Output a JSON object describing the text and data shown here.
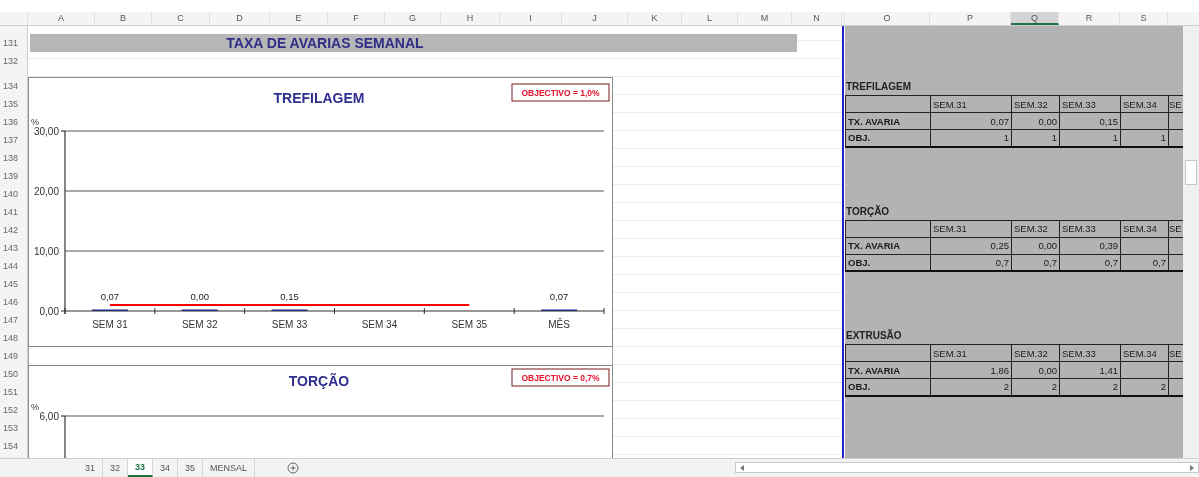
{
  "column_headers": [
    {
      "label": "A",
      "selected": false
    },
    {
      "label": "B",
      "selected": false
    },
    {
      "label": "C",
      "selected": false
    },
    {
      "label": "D",
      "selected": false
    },
    {
      "label": "E",
      "selected": false
    },
    {
      "label": "F",
      "selected": false
    },
    {
      "label": "G",
      "selected": false
    },
    {
      "label": "H",
      "selected": false
    },
    {
      "label": "I",
      "selected": false
    },
    {
      "label": "J",
      "selected": false
    },
    {
      "label": "K",
      "selected": false
    },
    {
      "label": "L",
      "selected": false
    },
    {
      "label": "M",
      "selected": false
    },
    {
      "label": "N",
      "selected": false
    },
    {
      "label": "O",
      "selected": false
    },
    {
      "label": "P",
      "selected": false
    },
    {
      "label": "Q",
      "selected": true
    },
    {
      "label": "R",
      "selected": false
    },
    {
      "label": "S",
      "selected": false
    }
  ],
  "row_numbers": [
    "131",
    "132",
    "134",
    "135",
    "136",
    "137",
    "138",
    "139",
    "140",
    "141",
    "142",
    "143",
    "144",
    "145",
    "146",
    "147",
    "148",
    "149",
    "150",
    "151",
    "152",
    "153",
    "154"
  ],
  "sheet_title": "TAXA DE AVARIAS SEMANAL",
  "charts": [
    {
      "chart_data": {
        "type": "bar",
        "title": "TREFILAGEM",
        "ylabel": "%",
        "categories": [
          "SEM 31",
          "SEM 32",
          "SEM 33",
          "SEM 34",
          "SEM 35",
          "MÊS"
        ],
        "series": [
          {
            "type": "bar",
            "color": "#1f2d7a",
            "values": [
              0.07,
              0,
              0.15,
              null,
              null,
              0.07
            ]
          },
          {
            "type": "line",
            "color": "#ff0000",
            "values": [
              1,
              1,
              1,
              1,
              1,
              null
            ]
          }
        ],
        "ylim": [
          0,
          30
        ],
        "yticks": [
          {
            "value": 0,
            "label": "0,00"
          },
          {
            "value": 10,
            "label": "10,00"
          },
          {
            "value": 20,
            "label": "20,00"
          },
          {
            "value": 30,
            "label": "30,00"
          }
        ],
        "value_labels": [
          "0,07",
          "0,00",
          "0,15",
          null,
          null,
          "0,07"
        ],
        "annotations": [
          "OBJECTIVO = 1,0%"
        ]
      }
    },
    {
      "title": "TORÇÃO",
      "annotations": [
        "OBJECTIVO = 0,7%"
      ],
      "ylabel": "%",
      "top_tick_label": "6,00"
    }
  ],
  "tables": [
    {
      "title": "TREFILAGEM",
      "columns": [
        "SEM.31",
        "SEM.32",
        "SEM.33",
        "SEM.34",
        "SE"
      ],
      "rows": [
        {
          "label": "TX. AVARIA",
          "cells": [
            "0,07",
            "0,00",
            "0,15"
          ]
        },
        {
          "label": "OBJ.",
          "cells": [
            "1",
            "1",
            "1",
            "1"
          ]
        }
      ]
    },
    {
      "title": "TORÇÃO",
      "columns": [
        "SEM.31",
        "SEM.32",
        "SEM.33",
        "SEM.34",
        "SE"
      ],
      "rows": [
        {
          "label": "TX. AVARIA",
          "cells": [
            "0,25",
            "0,00",
            "0,39"
          ]
        },
        {
          "label": "OBJ.",
          "cells": [
            "0,7",
            "0,7",
            "0,7",
            "0,7"
          ]
        }
      ]
    },
    {
      "title": "EXTRUSÃO",
      "columns": [
        "SEM.31",
        "SEM.32",
        "SEM.33",
        "SEM.34",
        "SE"
      ],
      "rows": [
        {
          "label": "TX. AVARIA",
          "cells": [
            "1,86",
            "0,00",
            "1,41"
          ]
        },
        {
          "label": "OBJ.",
          "cells": [
            "2",
            "2",
            "2",
            "2"
          ]
        }
      ]
    }
  ],
  "sheet_tabs": [
    {
      "label": "31",
      "selected": false
    },
    {
      "label": "32",
      "selected": false
    },
    {
      "label": "33",
      "selected": true
    },
    {
      "label": "34",
      "selected": false
    },
    {
      "label": "35",
      "selected": false
    },
    {
      "label": "MENSAL",
      "selected": false
    }
  ]
}
